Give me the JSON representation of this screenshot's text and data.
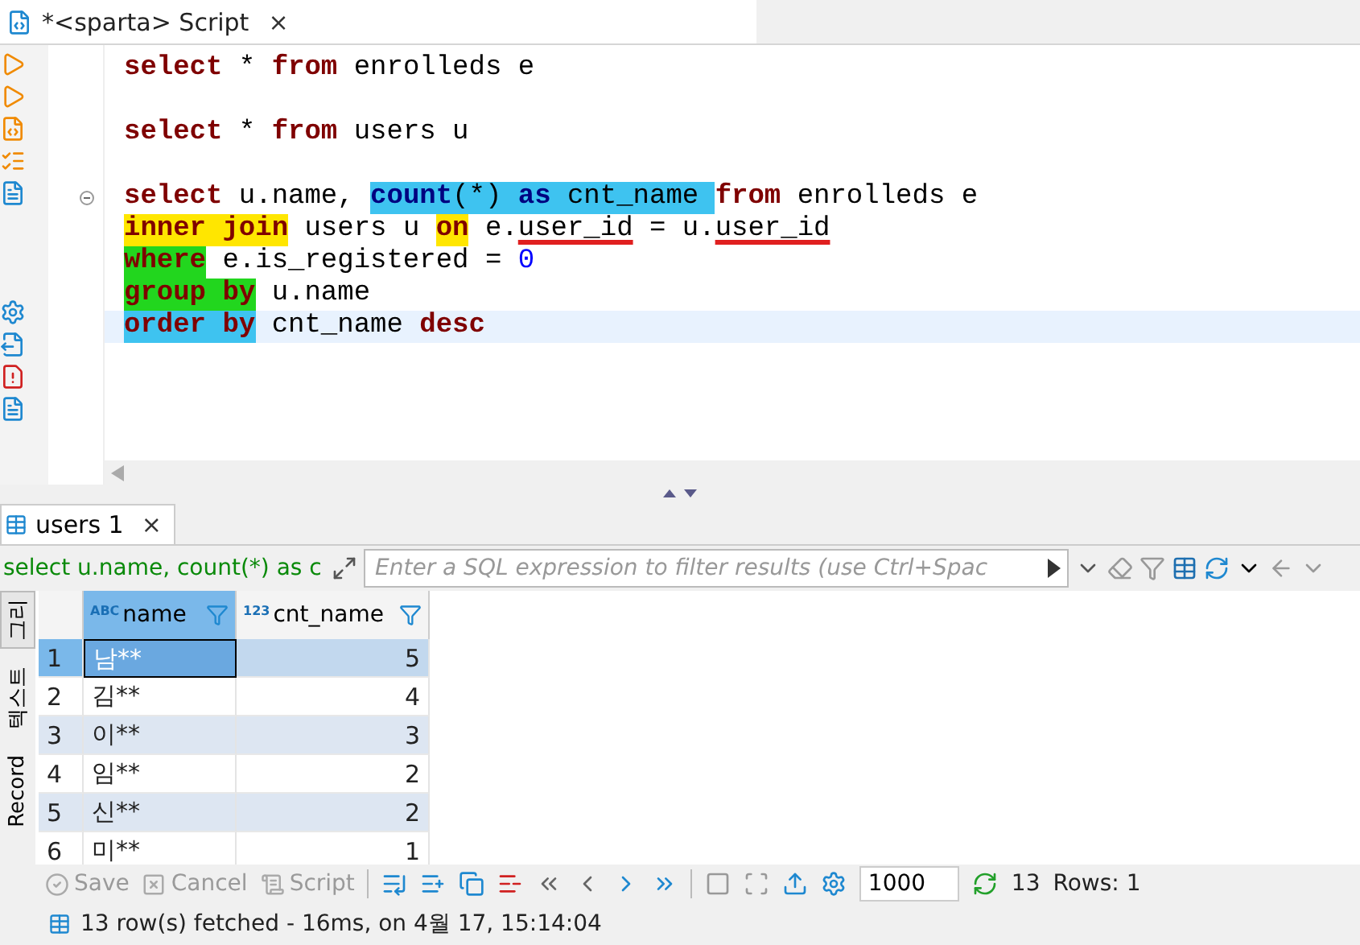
{
  "editor_tab": {
    "title": "*<sparta> Script",
    "close": "×"
  },
  "code_lines": [
    {
      "segments": [
        {
          "text": "select",
          "kind": "keyword"
        },
        {
          "text": " * ",
          "kind": "plain"
        },
        {
          "text": "from",
          "kind": "keyword"
        },
        {
          "text": " enrolleds e",
          "kind": "plain"
        }
      ]
    },
    {
      "spacer_before": true,
      "segments": [
        {
          "text": "select",
          "kind": "keyword"
        },
        {
          "text": " * ",
          "kind": "plain"
        },
        {
          "text": "from",
          "kind": "keyword"
        },
        {
          "text": " users u",
          "kind": "plain"
        }
      ]
    },
    {
      "spacer_before": true,
      "fold": true,
      "segments": [
        {
          "text": "select",
          "kind": "keyword"
        },
        {
          "text": " u.name, ",
          "kind": "plain"
        },
        {
          "text": "count",
          "kind": "function",
          "color": "#3ec3f0"
        },
        {
          "text": "(*) ",
          "kind": "plain",
          "color": "#3ec3f0"
        },
        {
          "text": "as",
          "kind": "function",
          "color": "#3ec3f0"
        },
        {
          "text": " cnt_name ",
          "kind": "plain",
          "color": "#3ec3f0"
        },
        {
          "text": "from",
          "kind": "keyword"
        },
        {
          "text": " enrolleds e",
          "kind": "plain"
        }
      ]
    },
    {
      "segments": [
        {
          "text": "inner join",
          "kind": "keyword",
          "color": "#ffe600"
        },
        {
          "text": " users u ",
          "kind": "plain"
        },
        {
          "text": "on",
          "kind": "keyword",
          "color": "#ffe600"
        },
        {
          "text": " e.",
          "kind": "plain"
        },
        {
          "text": "user_id",
          "kind": "plain",
          "underline": true
        },
        {
          "text": " = u.",
          "kind": "plain"
        },
        {
          "text": "user_id",
          "kind": "plain",
          "underline": true
        }
      ]
    },
    {
      "segments": [
        {
          "text": "where",
          "kind": "keyword",
          "color": "#22d61e"
        },
        {
          "text": " e.is_registered = ",
          "kind": "plain"
        },
        {
          "text": "0",
          "kind": "number"
        }
      ]
    },
    {
      "segments": [
        {
          "text": "group by",
          "kind": "keyword",
          "color": "#22d61e"
        },
        {
          "text": " u.name",
          "kind": "plain"
        }
      ]
    },
    {
      "current": true,
      "segments": [
        {
          "text": "order by",
          "kind": "keyword",
          "color": "#3ec3f0"
        },
        {
          "text": " cnt_name ",
          "kind": "plain"
        },
        {
          "text": "desc",
          "kind": "keyword"
        }
      ]
    }
  ],
  "results_tab": {
    "title": "users 1",
    "close": "×"
  },
  "filter": {
    "query": "select u.name, count(*) as c",
    "placeholder": "Enter a SQL expression to filter results (use Ctrl+Spac"
  },
  "side_tabs": [
    {
      "label": "그리",
      "selected": true
    },
    {
      "label": "텍스트",
      "selected": false
    },
    {
      "label": "Record",
      "selected": false
    }
  ],
  "columns": [
    {
      "type": "ABC",
      "name": "name",
      "selected": true
    },
    {
      "type": "123",
      "name": "cnt_name",
      "selected": false
    }
  ],
  "rows": [
    {
      "number": "1",
      "name": "남**",
      "cnt_name": "5",
      "selected": true
    },
    {
      "number": "2",
      "name": "김**",
      "cnt_name": "4",
      "selected": false
    },
    {
      "number": "3",
      "name": "이**",
      "cnt_name": "3",
      "selected": false
    },
    {
      "number": "4",
      "name": "임**",
      "cnt_name": "2",
      "selected": false
    },
    {
      "number": "5",
      "name": "신**",
      "cnt_name": "2",
      "selected": false
    },
    {
      "number": "6",
      "name": "미**",
      "cnt_name": "1",
      "selected": false
    }
  ],
  "toolbar": {
    "actions": [
      {
        "label": "Save",
        "disabled": true
      },
      {
        "label": "Cancel",
        "disabled": true
      },
      {
        "label": "Script",
        "disabled": true
      }
    ],
    "fetch_size": "1000",
    "count": "13",
    "rows_label": "Rows: 1"
  },
  "status": "13 row(s) fetched - 16ms, on 4월 17, 15:14:04"
}
